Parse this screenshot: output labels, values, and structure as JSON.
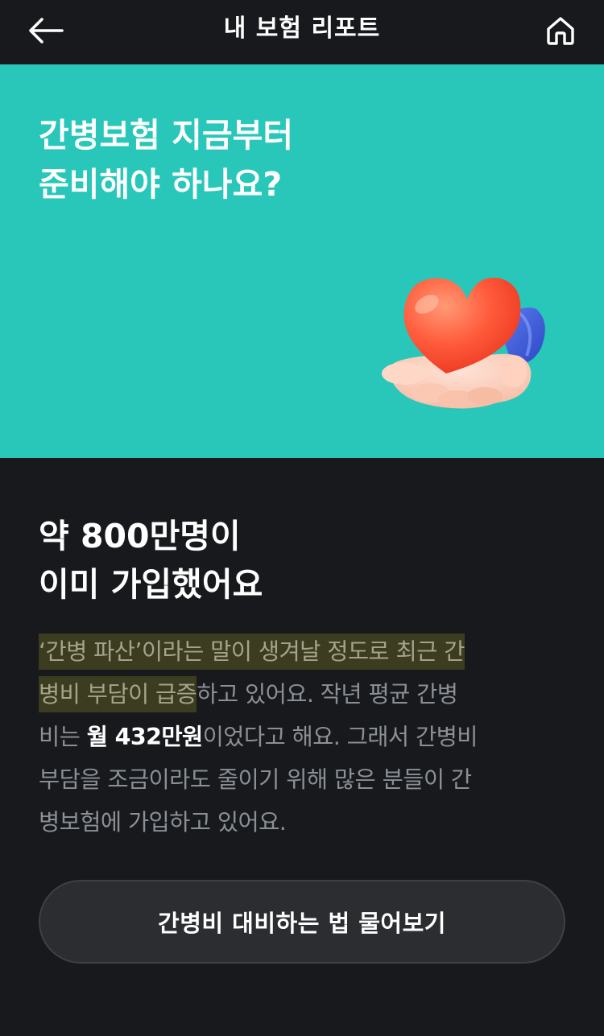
{
  "header": {
    "title": "내 보험 리포트",
    "back_icon": "arrow-left-icon",
    "home_icon": "home-icon"
  },
  "hero": {
    "title_line1": "간병보험 지금부터",
    "title_line2": "준비해야 하나요?",
    "illustration": "heart-in-hand-illustration",
    "background_color": "#28c7b9"
  },
  "section": {
    "title_line1": "약 800만명이",
    "title_line2": "이미 가입했어요"
  },
  "body": {
    "l1_highlight": "‘간병 파산’이라는 말이 생겨날 정도로 최근 간",
    "l2_highlight": "병비 부담이 급증",
    "l2_rest": "하고 있어요. 작년 평균 간병",
    "l3_start": "비는 ",
    "l3_strong": "월 432만원",
    "l3_rest": "이었다고 해요. 그래서 간병비",
    "l4": "부담을 조금이라도 줄이기 위해 많은 분들이 간",
    "l5": "병보험에 가입하고 있어요."
  },
  "cta": {
    "label": "간병비 대비하는 법 물어보기"
  }
}
